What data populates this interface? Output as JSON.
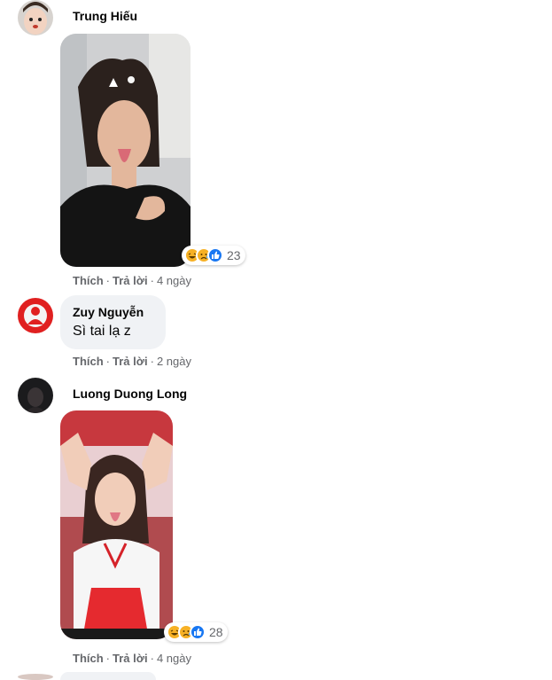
{
  "comments": [
    {
      "author": "Trung Hiếu",
      "reaction_count": "23",
      "reactions": [
        "haha-icon",
        "sad-icon",
        "like-icon"
      ],
      "like_label": "Thích",
      "reply_label": "Trả lời",
      "time": "4 ngày"
    },
    {
      "author": "Zuy Nguyễn",
      "text": "Sì tai lạ z",
      "like_label": "Thích",
      "reply_label": "Trả lời",
      "time": "2 ngày"
    },
    {
      "author": "Luong Duong Long",
      "reaction_count": "28",
      "reactions": [
        "haha-icon",
        "sad-icon",
        "like-icon"
      ],
      "like_label": "Thích",
      "reply_label": "Trả lời",
      "time": "4 ngày"
    }
  ],
  "separator": "·",
  "colors": {
    "bubble": "#f0f2f5",
    "meta_text": "#65676b",
    "like_blue": "#1877f2",
    "haha_yellow": "#f7b125"
  }
}
